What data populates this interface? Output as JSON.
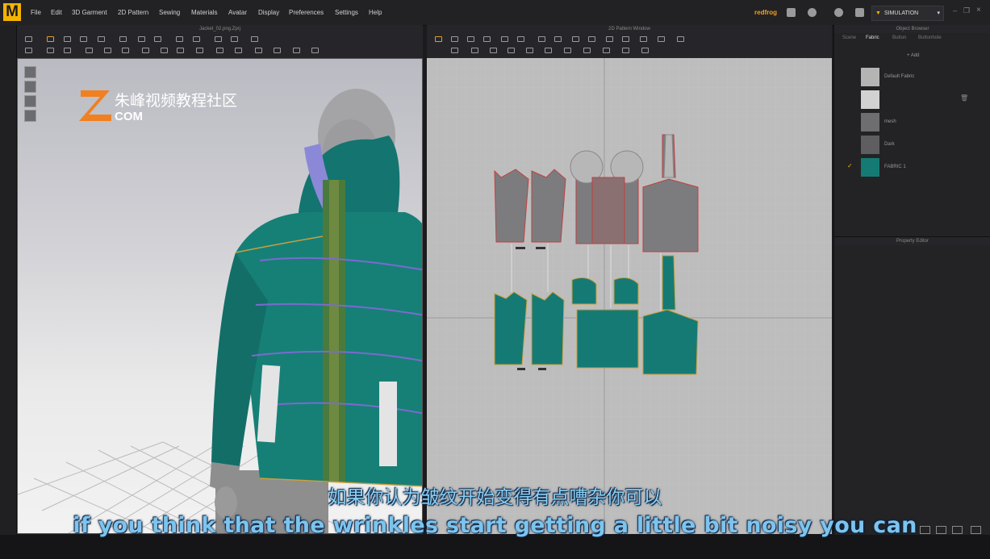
{
  "app": {
    "logo_letter": "M",
    "menu": [
      "File",
      "Edit",
      "3D Garment",
      "2D Pattern",
      "Sewing",
      "Materials",
      "Avatar",
      "Display",
      "Preferences",
      "Settings",
      "Help"
    ],
    "user": "redfrog",
    "mode": "SIMULATION"
  },
  "panels": {
    "view3d_title": "Jacket_02.png.Zprj",
    "view2d_title": "2D Pattern Window",
    "object_browser_title": "Object Browser",
    "property_editor_title": "Property Editor"
  },
  "object_browser": {
    "tabs": [
      "Scene",
      "Fabric",
      "Button",
      "Buttonhole"
    ],
    "active_tab": "Fabric",
    "add_label": "+ Add",
    "fabrics": [
      {
        "name": "Default Fabric",
        "color": "#b4b4b4",
        "selected": false
      },
      {
        "name": "",
        "color": "#d2d2d2",
        "selected": false
      },
      {
        "name": "mesh",
        "color": "#6e6e70",
        "selected": false
      },
      {
        "name": "Dark",
        "color": "#5e5e60",
        "selected": false
      },
      {
        "name": "FABRIC 1",
        "color": "#167a74",
        "selected": true
      }
    ]
  },
  "watermark": {
    "text": "朱峰视频教程社区",
    "sub": "COM"
  },
  "subtitles": {
    "chinese": "如果你认为皱纹开始变得有点嘈杂你可以",
    "english": "if you think that the wrinkles start getting a little bit noisy you can"
  },
  "colors": {
    "accent": "#f5b400",
    "fabric": "#167a74",
    "stitch": "#c8a040"
  }
}
